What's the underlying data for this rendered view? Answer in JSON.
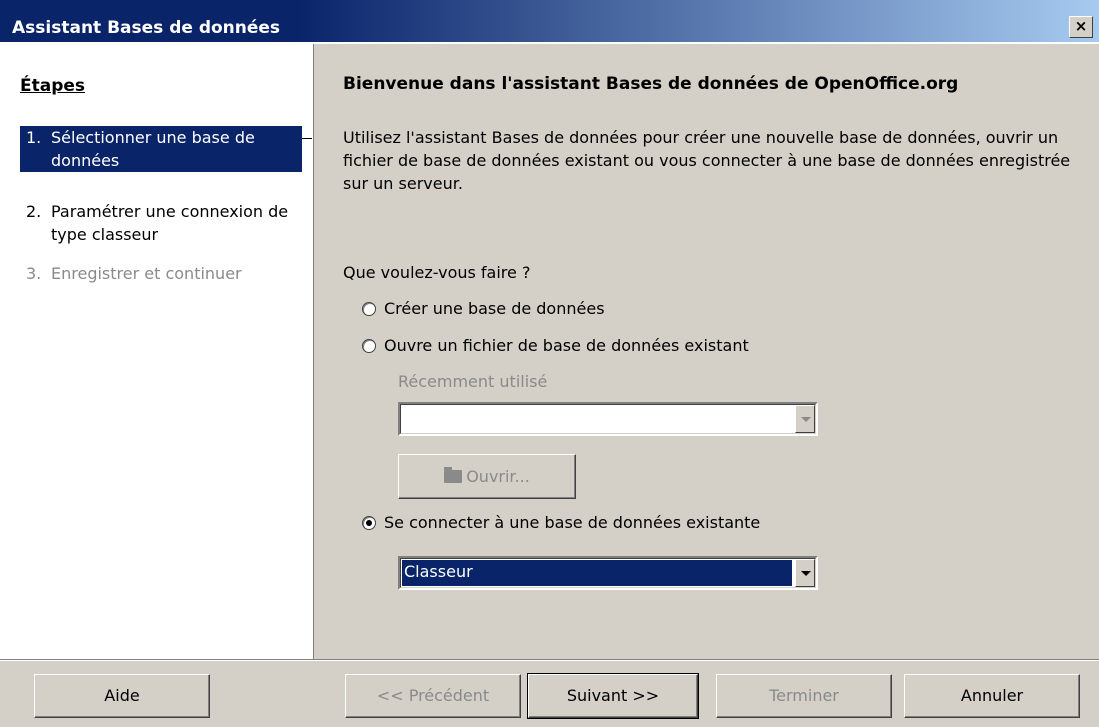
{
  "window": {
    "title": "Assistant Bases de données",
    "close_label": "×"
  },
  "steps": {
    "title": "Étapes",
    "items": [
      {
        "num": "1.",
        "label": "Sélectionner une base de données",
        "state": "active"
      },
      {
        "num": "2.",
        "label": "Paramétrer une connexion de type classeur",
        "state": "normal"
      },
      {
        "num": "3.",
        "label": "Enregistrer et continuer",
        "state": "disabled"
      }
    ]
  },
  "main": {
    "heading": "Bienvenue dans l'assistant Bases de données de OpenOffice.org",
    "intro": "Utilisez l'assistant Bases de données pour créer une nouvelle base de données, ouvrir un fichier de base de données existant ou vous connecter à une base de données enregistrée sur un serveur.",
    "question": "Que voulez-vous faire ?",
    "options": [
      {
        "label": "Créer une base de données",
        "checked": false
      },
      {
        "label": "Ouvre un fichier de base de données existant",
        "checked": false
      },
      {
        "label": "Se connecter à une base de données existante",
        "checked": true
      }
    ],
    "recent_label": "Récemment utilisé",
    "recent_value": "",
    "open_button": "Ouvrir...",
    "connection_type": "Classeur"
  },
  "footer": {
    "help": "Aide",
    "previous": "<< Précédent",
    "next": "Suivant >>",
    "finish": "Terminer",
    "cancel": "Annuler"
  }
}
